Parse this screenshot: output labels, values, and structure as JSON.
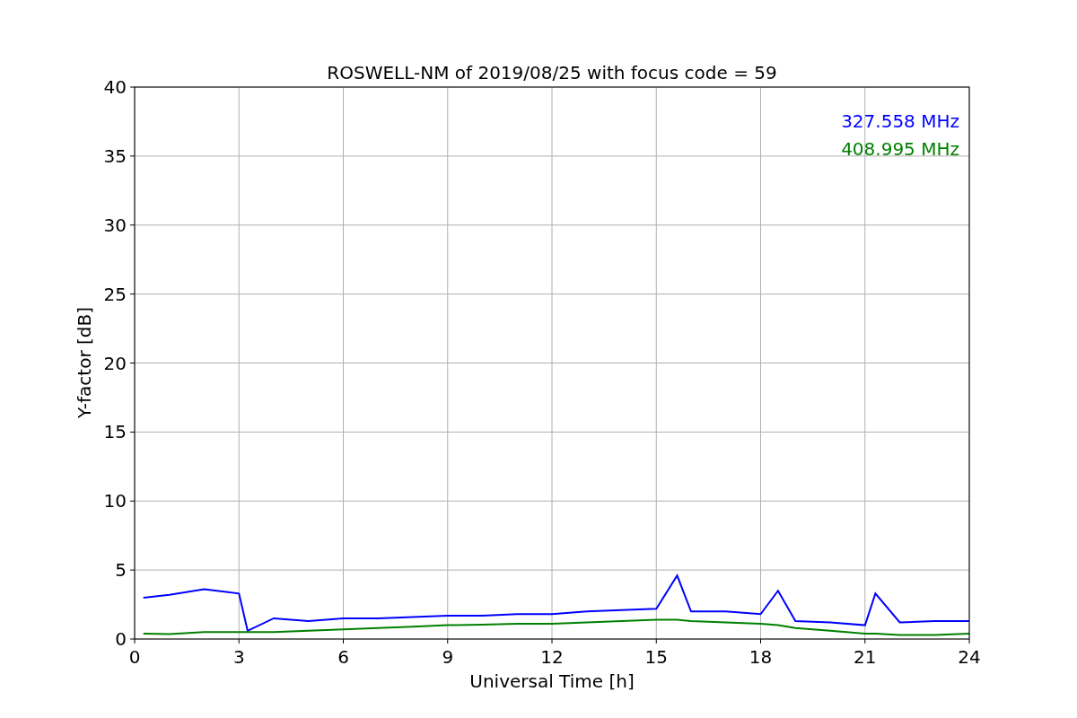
{
  "chart_data": {
    "type": "line",
    "title": "ROSWELL-NM of 2019/08/25 with focus code = 59",
    "xlabel": "Universal Time [h]",
    "ylabel": "Y-factor [dB]",
    "x": [
      0.25,
      1,
      2,
      3,
      3.25,
      4,
      5,
      6,
      7,
      8,
      9,
      10,
      11,
      12,
      13,
      14,
      15,
      15.6,
      16,
      17,
      18,
      18.5,
      19,
      20,
      21,
      21.3,
      22,
      23,
      24
    ],
    "series": [
      {
        "name": "327.558 MHz",
        "color": "#0000ff",
        "values": [
          3.0,
          3.2,
          3.6,
          3.3,
          0.6,
          1.5,
          1.3,
          1.5,
          1.5,
          1.6,
          1.7,
          1.7,
          1.8,
          1.8,
          2.0,
          2.1,
          2.2,
          4.6,
          2.0,
          2.0,
          1.8,
          3.5,
          1.3,
          1.2,
          1.0,
          3.3,
          1.2,
          1.3,
          1.3
        ]
      },
      {
        "name": "408.995 MHz",
        "color": "#008000",
        "values": [
          0.4,
          0.35,
          0.5,
          0.5,
          0.5,
          0.5,
          0.6,
          0.7,
          0.8,
          0.9,
          1.0,
          1.05,
          1.1,
          1.1,
          1.2,
          1.3,
          1.4,
          1.4,
          1.3,
          1.2,
          1.1,
          1.0,
          0.8,
          0.6,
          0.4,
          0.4,
          0.3,
          0.3,
          0.4
        ]
      }
    ],
    "xlim": [
      0,
      24
    ],
    "ylim": [
      0,
      40
    ],
    "xticks": [
      0,
      3,
      6,
      9,
      12,
      15,
      18,
      21,
      24
    ],
    "yticks": [
      0,
      5,
      10,
      15,
      20,
      25,
      30,
      35,
      40
    ],
    "grid": true
  }
}
